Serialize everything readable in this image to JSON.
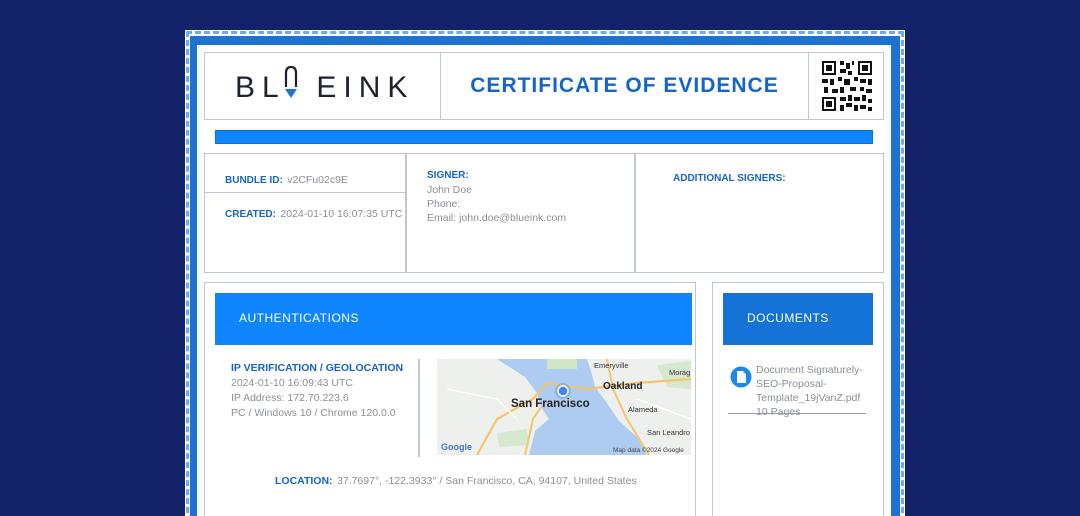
{
  "logo": {
    "text": "BLUEINK"
  },
  "header": {
    "title": "CERTIFICATE OF EVIDENCE"
  },
  "bundle": {
    "label": "BUNDLE ID:",
    "value": "v2CFu02c9E"
  },
  "created": {
    "label": "CREATED:",
    "value": "2024-01-10 16:07:35 UTC"
  },
  "signer": {
    "label": "SIGNER:",
    "name": "John Doe",
    "phone": "Phone:",
    "email": "Email: john.doe@blueink.com"
  },
  "additional_signers": {
    "label": "ADDITIONAL SIGNERS:"
  },
  "authentications": {
    "heading": "AUTHENTICATIONS",
    "ip_label": "IP VERIFICATION / GEOLOCATION",
    "timestamp": "2024-01-10 16:09:43 UTC",
    "ip": "IP Address: 172.70.223.6",
    "device": "PC / Windows 10 / Chrome 120.0.0",
    "location_label": "LOCATION:",
    "location_value": "37.7697°, -122.3933° / San Francisco, CA, 94107, United States",
    "map": {
      "labels": [
        "San Francisco",
        "Oakland",
        "Emeryville",
        "Alameda",
        "San Leandro",
        "Morag"
      ],
      "brand": "Google",
      "attribution": "Map data ©2024 Google"
    }
  },
  "documents": {
    "heading": "DOCUMENTS",
    "name": "Document Signaturely-SEO-Proposal-Template_19jVanZ.pdf",
    "pages": "10 Pages"
  },
  "colors": {
    "background": "#14226a",
    "accent_blue": "#0f86ff",
    "title_blue": "#1664c8",
    "muted_text": "#8a8f98"
  }
}
